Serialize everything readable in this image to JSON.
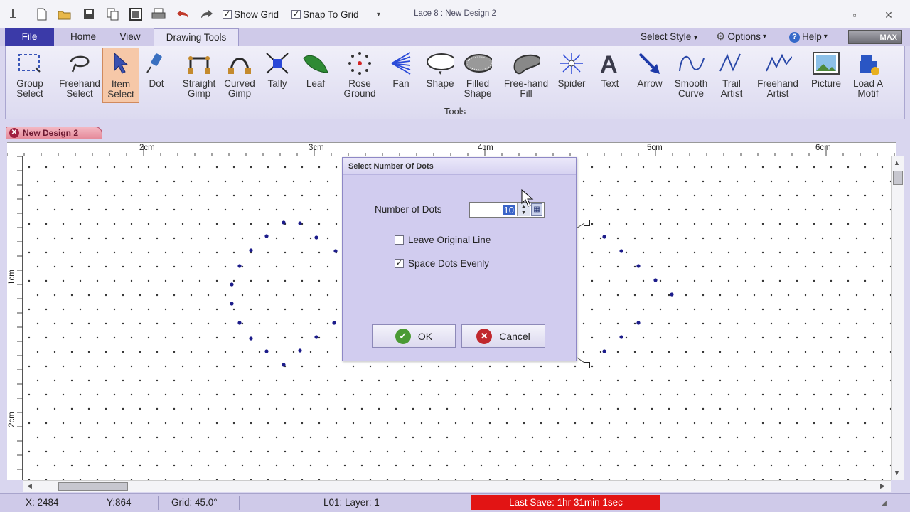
{
  "window": {
    "title": "Lace 8 : New Design 2",
    "quick_access": {
      "show_grid_label": "Show Grid",
      "show_grid_checked": true,
      "snap_to_grid_label": "Snap To Grid",
      "snap_to_grid_checked": true
    }
  },
  "ribbon": {
    "tabs": [
      "File",
      "Home",
      "View",
      "Drawing Tools"
    ],
    "active_tab": "Drawing Tools",
    "right_menu": {
      "select_style": "Select Style",
      "options": "Options",
      "help": "Help",
      "max": "MAX"
    },
    "group_label": "Tools",
    "tools": [
      {
        "label": "Group\nSelect",
        "icon": "group-select-icon"
      },
      {
        "label": "Freehand\nSelect",
        "icon": "freehand-select-icon"
      },
      {
        "label": "Item\nSelect",
        "icon": "item-select-icon",
        "selected": true
      },
      {
        "label": "Dot",
        "icon": "dot-tool-icon"
      },
      {
        "label": "Straight\nGimp",
        "icon": "straight-gimp-icon"
      },
      {
        "label": "Curved\nGimp",
        "icon": "curved-gimp-icon"
      },
      {
        "label": "Tally",
        "icon": "tally-icon"
      },
      {
        "label": "Leaf",
        "icon": "leaf-icon"
      },
      {
        "label": "Rose\nGround",
        "icon": "rose-ground-icon"
      },
      {
        "label": "Fan",
        "icon": "fan-icon"
      },
      {
        "label": "Shape",
        "icon": "shape-icon"
      },
      {
        "label": "Filled\nShape",
        "icon": "filled-shape-icon"
      },
      {
        "label": "Free-hand\nFill",
        "icon": "freehand-fill-icon"
      },
      {
        "label": "Spider",
        "icon": "spider-icon"
      },
      {
        "label": "Text",
        "icon": "text-icon"
      },
      {
        "label": "Arrow",
        "icon": "arrow-icon"
      },
      {
        "label": "Smooth\nCurve",
        "icon": "smooth-curve-icon"
      },
      {
        "label": "Trail\nArtist",
        "icon": "trail-artist-icon"
      },
      {
        "label": "Freehand\nArtist",
        "icon": "freehand-artist-icon"
      },
      {
        "label": "Picture",
        "icon": "picture-icon"
      },
      {
        "label": "Load A\nMotif",
        "icon": "load-motif-icon"
      }
    ]
  },
  "document": {
    "tab_label": "New Design 2",
    "ruler_h_labels": [
      "2cm",
      "3cm",
      "4cm",
      "5cm",
      "6cm"
    ],
    "ruler_v_labels": [
      "1cm",
      "2cm"
    ]
  },
  "dialog": {
    "title": "Select Number Of Dots",
    "number_label": "Number of Dots",
    "number_value": "10",
    "leave_original_label": "Leave Original Line",
    "leave_original_checked": false,
    "space_evenly_label": "Space Dots Evenly",
    "space_evenly_checked": true,
    "ok_label": "OK",
    "cancel_label": "Cancel"
  },
  "status": {
    "x": "X: 2484",
    "y": "Y:864",
    "grid": "Grid: 45.0°",
    "layer": "L01: Layer: 1",
    "last_save": "Last Save: 1hr 31min 1sec"
  },
  "colors": {
    "accent": "#3b3aa8",
    "dot": "#1c1c8a",
    "last_save_bg": "#e21414",
    "dialog_bg": "#d1ccef"
  }
}
